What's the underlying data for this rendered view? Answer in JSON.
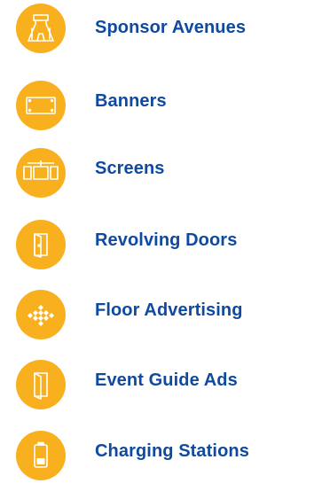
{
  "colors": {
    "accent": "#F9B01E",
    "text": "#0F4AA0",
    "icon_stroke": "#FFFFFF"
  },
  "items": [
    {
      "label": "Sponsor Avenues",
      "icon": "sponsor-avenue-icon"
    },
    {
      "label": "Banners",
      "icon": "banner-icon"
    },
    {
      "label": "Screens",
      "icon": "screens-icon"
    },
    {
      "label": "Revolving Doors",
      "icon": "door-icon"
    },
    {
      "label": "Floor Advertising",
      "icon": "floor-tiles-icon"
    },
    {
      "label": "Event Guide Ads",
      "icon": "folded-guide-icon"
    },
    {
      "label": "Charging Stations",
      "icon": "battery-icon"
    }
  ]
}
